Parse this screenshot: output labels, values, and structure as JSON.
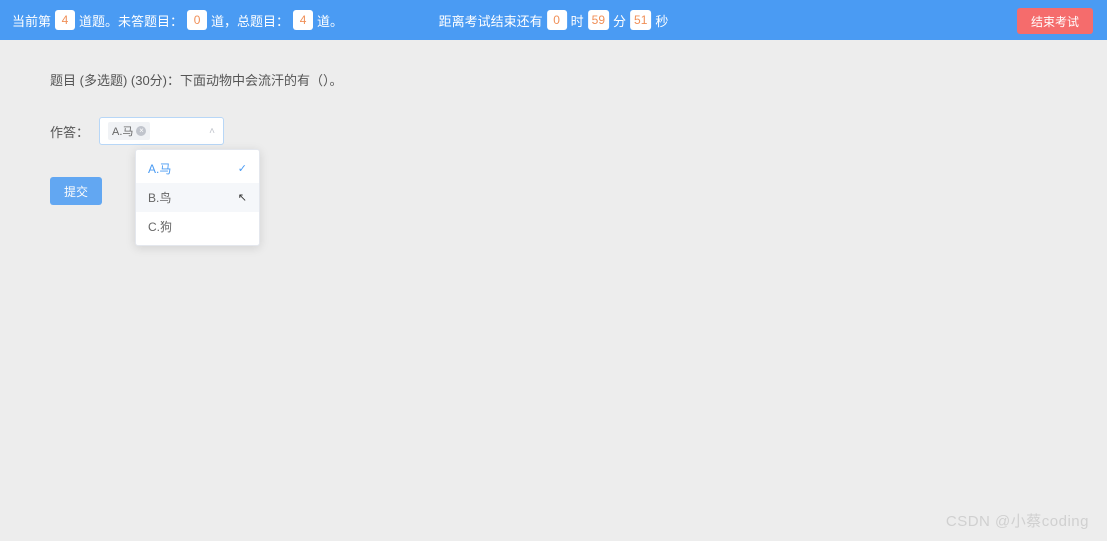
{
  "topbar": {
    "current_prefix": "当前第",
    "current_num": "4",
    "current_suffix": "道题。未答题目：",
    "unanswered_num": "0",
    "mid_text": "道，总题目：",
    "total_num": "4",
    "total_suffix": "道。",
    "timer_prefix": "距离考试结束还有",
    "hours": "0",
    "hours_unit": "时",
    "minutes": "59",
    "minutes_unit": "分",
    "seconds": "51",
    "seconds_unit": "秒",
    "end_label": "结束考试"
  },
  "question": {
    "text": "题目 (多选题) (30分)：下面动物中会流汗的有（）。"
  },
  "answer": {
    "label": "作答：",
    "selected_tag": "A.马",
    "options": [
      {
        "label": "A.马",
        "selected": true,
        "hovered": false
      },
      {
        "label": "B.鸟",
        "selected": false,
        "hovered": true
      },
      {
        "label": "C.狗",
        "selected": false,
        "hovered": false
      }
    ]
  },
  "submit_label": "提交",
  "watermark": "CSDN @小蔡coding"
}
